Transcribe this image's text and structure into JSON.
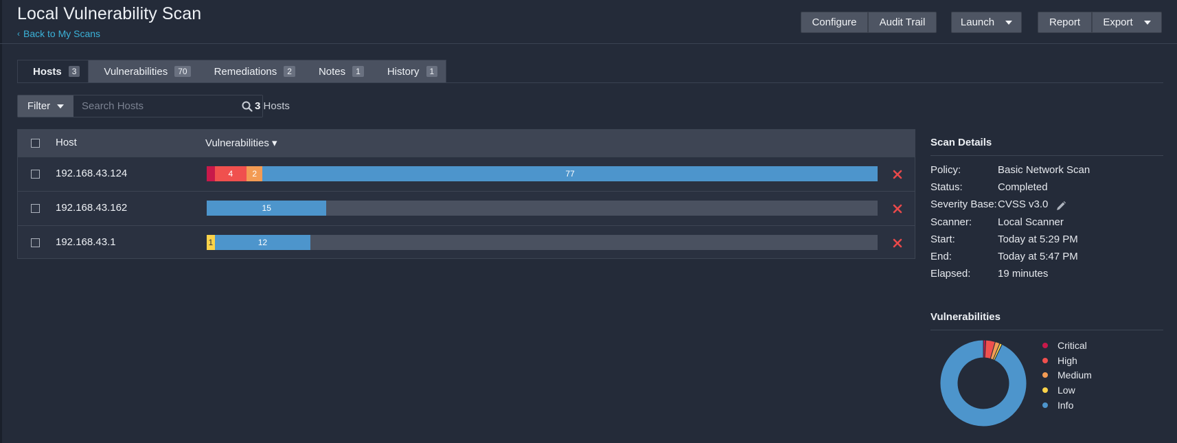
{
  "header": {
    "title": "Local Vulnerability Scan",
    "back_link": "Back to My Scans",
    "buttons": {
      "configure": "Configure",
      "audit_trail": "Audit Trail",
      "launch": "Launch",
      "report": "Report",
      "export": "Export"
    }
  },
  "tabs": [
    {
      "label": "Hosts",
      "count": "3"
    },
    {
      "label": "Vulnerabilities",
      "count": "70"
    },
    {
      "label": "Remediations",
      "count": "2"
    },
    {
      "label": "Notes",
      "count": "1"
    },
    {
      "label": "History",
      "count": "1"
    }
  ],
  "filter": {
    "button_label": "Filter",
    "search_placeholder": "Search Hosts",
    "count_number": "3",
    "count_label": "Hosts"
  },
  "table": {
    "columns": {
      "host": "Host",
      "vulnerabilities": "Vulnerabilities ▾"
    },
    "rows": [
      {
        "host": "192.168.43.124",
        "critical": 1,
        "high": 4,
        "medium": 2,
        "low": 0,
        "info": 77,
        "labels": {
          "critical": "",
          "high": "4",
          "medium": "2",
          "low": "",
          "info": "77"
        }
      },
      {
        "host": "192.168.43.162",
        "critical": 0,
        "high": 0,
        "medium": 0,
        "low": 0,
        "info": 15,
        "labels": {
          "critical": "",
          "high": "",
          "medium": "",
          "low": "",
          "info": "15"
        }
      },
      {
        "host": "192.168.43.1",
        "critical": 0,
        "high": 0,
        "medium": 0,
        "low": 1,
        "info": 12,
        "labels": {
          "critical": "",
          "high": "",
          "medium": "",
          "low": "1",
          "info": "12"
        }
      }
    ]
  },
  "scan_details": {
    "title": "Scan Details",
    "items": [
      {
        "label": "Policy:",
        "value": "Basic Network Scan"
      },
      {
        "label": "Status:",
        "value": "Completed"
      },
      {
        "label": "Severity Base:",
        "value": "CVSS v3.0"
      },
      {
        "label": "Scanner:",
        "value": "Local Scanner"
      },
      {
        "label": "Start:",
        "value": "Today at 5:29 PM"
      },
      {
        "label": "End:",
        "value": "Today at 5:47 PM"
      },
      {
        "label": "Elapsed:",
        "value": "19 minutes"
      }
    ]
  },
  "vuln_chart": {
    "title": "Vulnerabilities",
    "legend": [
      {
        "label": "Critical",
        "color": "#c8194a"
      },
      {
        "label": "High",
        "color": "#f0504e"
      },
      {
        "label": "Medium",
        "color": "#f39b54"
      },
      {
        "label": "Low",
        "color": "#fbd34a"
      },
      {
        "label": "Info",
        "color": "#4d95cc"
      }
    ]
  },
  "chart_data": {
    "type": "pie",
    "categories": [
      "Critical",
      "High",
      "Medium",
      "Low",
      "Info"
    ],
    "values": [
      1,
      4,
      2,
      1,
      104
    ],
    "colors": [
      "#c8194a",
      "#f0504e",
      "#f39b54",
      "#fbd34a",
      "#4d95cc"
    ],
    "title": "Vulnerabilities",
    "legend": "right"
  }
}
